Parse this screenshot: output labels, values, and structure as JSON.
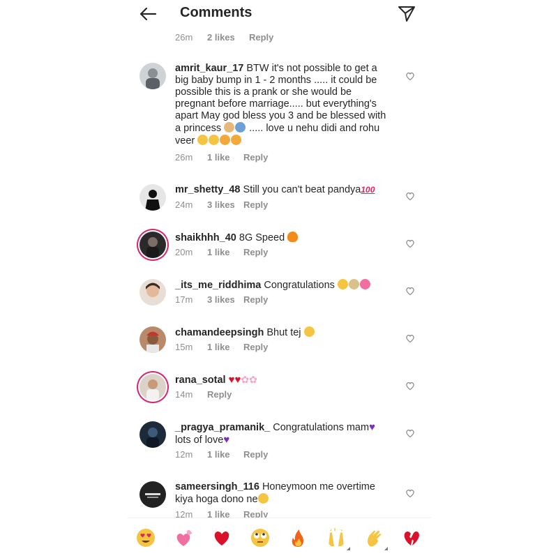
{
  "header": {
    "title": "Comments"
  },
  "top_meta": {
    "time": "26m",
    "likes": "2 likes",
    "reply": "Reply"
  },
  "comments": [
    {
      "username": "amrit_kaur_17",
      "text": "BTW it's not possible to get a big baby bump in 1 - 2 months ..... it could be possible this is a prank or she would be pregnant before marriage..... but everything's apart May god bless you 3 and be blessed with a princess",
      "text2": "..... love u nehu didi and rohu veer",
      "time": "26m",
      "likes": "1 like",
      "reply": "Reply"
    },
    {
      "username": "mr_shetty_48",
      "text": "Still you can't beat pandya",
      "time": "24m",
      "likes": "3 likes",
      "reply": "Reply"
    },
    {
      "username": "shaikhhh_40",
      "text": "8G Speed",
      "time": "20m",
      "likes": "1 like",
      "reply": "Reply"
    },
    {
      "username": "_its_me_riddhima",
      "text": "Congratulations",
      "time": "17m",
      "likes": "3 likes",
      "reply": "Reply"
    },
    {
      "username": "chamandeepsingh",
      "text": "Bhut tej",
      "time": "15m",
      "likes": "1 like",
      "reply": "Reply"
    },
    {
      "username": "rana_sotal",
      "text": "",
      "time": "14m",
      "likes": "",
      "reply": "Reply"
    },
    {
      "username": "_pragya_pramanik_",
      "text": "Congratulations mam",
      "text2": "lots of love",
      "time": "12m",
      "likes": "1 like",
      "reply": "Reply"
    },
    {
      "username": "sameersingh_116",
      "text": "Honeymoon me overtime kiya hoga dono ne",
      "time": "12m",
      "likes": "1 like",
      "reply": "Reply"
    }
  ],
  "emoji_bar": [
    "heart-eyes-emoji",
    "two-hearts-emoji",
    "red-heart-emoji",
    "rolling-eyes-emoji",
    "fire-emoji",
    "raised-hands-emoji",
    "clapping-hands-emoji",
    "broken-heart-emoji"
  ],
  "colors": {
    "text": "#262626",
    "meta": "#8e8e8e",
    "story_ring": "#d6276f"
  }
}
